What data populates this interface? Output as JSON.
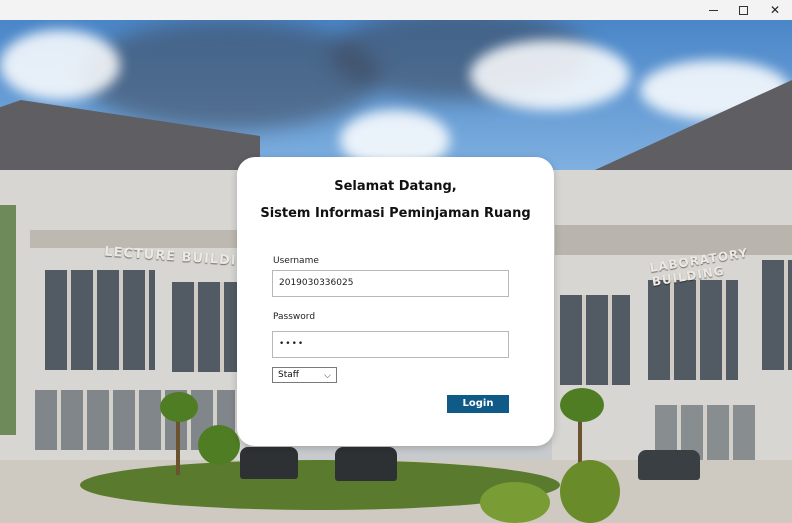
{
  "window": {
    "controls": [
      "minimize",
      "maximize",
      "close"
    ]
  },
  "background": {
    "left_sign": "LECTURE BUILDING",
    "right_sign": "LABORATORY BUILDING"
  },
  "login": {
    "welcome": "Selamat Datang,",
    "subtitle": "Sistem Informasi Peminjaman Ruang",
    "username_label": "Username",
    "username_value": "2019030336025",
    "password_label": "Password",
    "password_value": "••••",
    "role_selected": "Staff",
    "login_label": "Login"
  },
  "colors": {
    "login_button": "#0f5a86",
    "card_bg": "#ffffff"
  }
}
